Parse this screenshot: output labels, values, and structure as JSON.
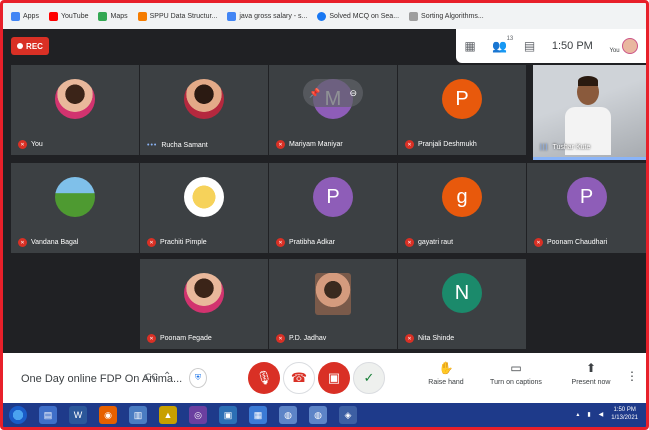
{
  "bookmarks": [
    {
      "label": "Apps",
      "color": "#4285f4"
    },
    {
      "label": "YouTube",
      "color": "#ff0000"
    },
    {
      "label": "Maps",
      "color": "#34a853"
    },
    {
      "label": "SPPU Data Structur...",
      "color": "#f57c00"
    },
    {
      "label": "java gross salary - s...",
      "color": "#4285f4"
    },
    {
      "label": "Solved MCQ on Sea...",
      "color": "#1877f2"
    },
    {
      "label": "Sorting Algorithms...",
      "color": "#9e9e9e"
    }
  ],
  "meet": {
    "rec_label": "REC",
    "participant_count": "13",
    "time": "1:50 PM",
    "you_label": "You"
  },
  "tiles": [
    {
      "name": "You",
      "initial": "",
      "bg": ""
    },
    {
      "name": "Rucha Samant",
      "initial": "",
      "bg": ""
    },
    {
      "name": "Mariyam Maniyar",
      "initial": "M",
      "bg": "#8e5db8"
    },
    {
      "name": "Pranjali Deshmukh",
      "initial": "P",
      "bg": "#e8590c"
    },
    {
      "name": "Tushar Kute",
      "initial": "",
      "bg": ""
    },
    {
      "name": "Vandana Bagal",
      "initial": "",
      "bg": ""
    },
    {
      "name": "Prachiti Pimple",
      "initial": "",
      "bg": ""
    },
    {
      "name": "Pratibha Adkar",
      "initial": "P",
      "bg": "#8e5db8"
    },
    {
      "name": "gayatri raut",
      "initial": "g",
      "bg": "#e8590c"
    },
    {
      "name": "Poonam Chaudhari",
      "initial": "P",
      "bg": "#8e5db8"
    },
    {
      "name": "Poonam Fegade",
      "initial": "",
      "bg": ""
    },
    {
      "name": "P.D. Jadhav",
      "initial": "",
      "bg": ""
    },
    {
      "name": "Nita Shinde",
      "initial": "N",
      "bg": "#1b8a6b"
    }
  ],
  "controls": {
    "meeting_title": "One Day online FDP On Anima...",
    "raise_hand": "Raise hand",
    "captions": "Turn on captions",
    "present": "Present now"
  },
  "taskbar": {
    "time": "1:50 PM",
    "date": "1/13/2021"
  }
}
